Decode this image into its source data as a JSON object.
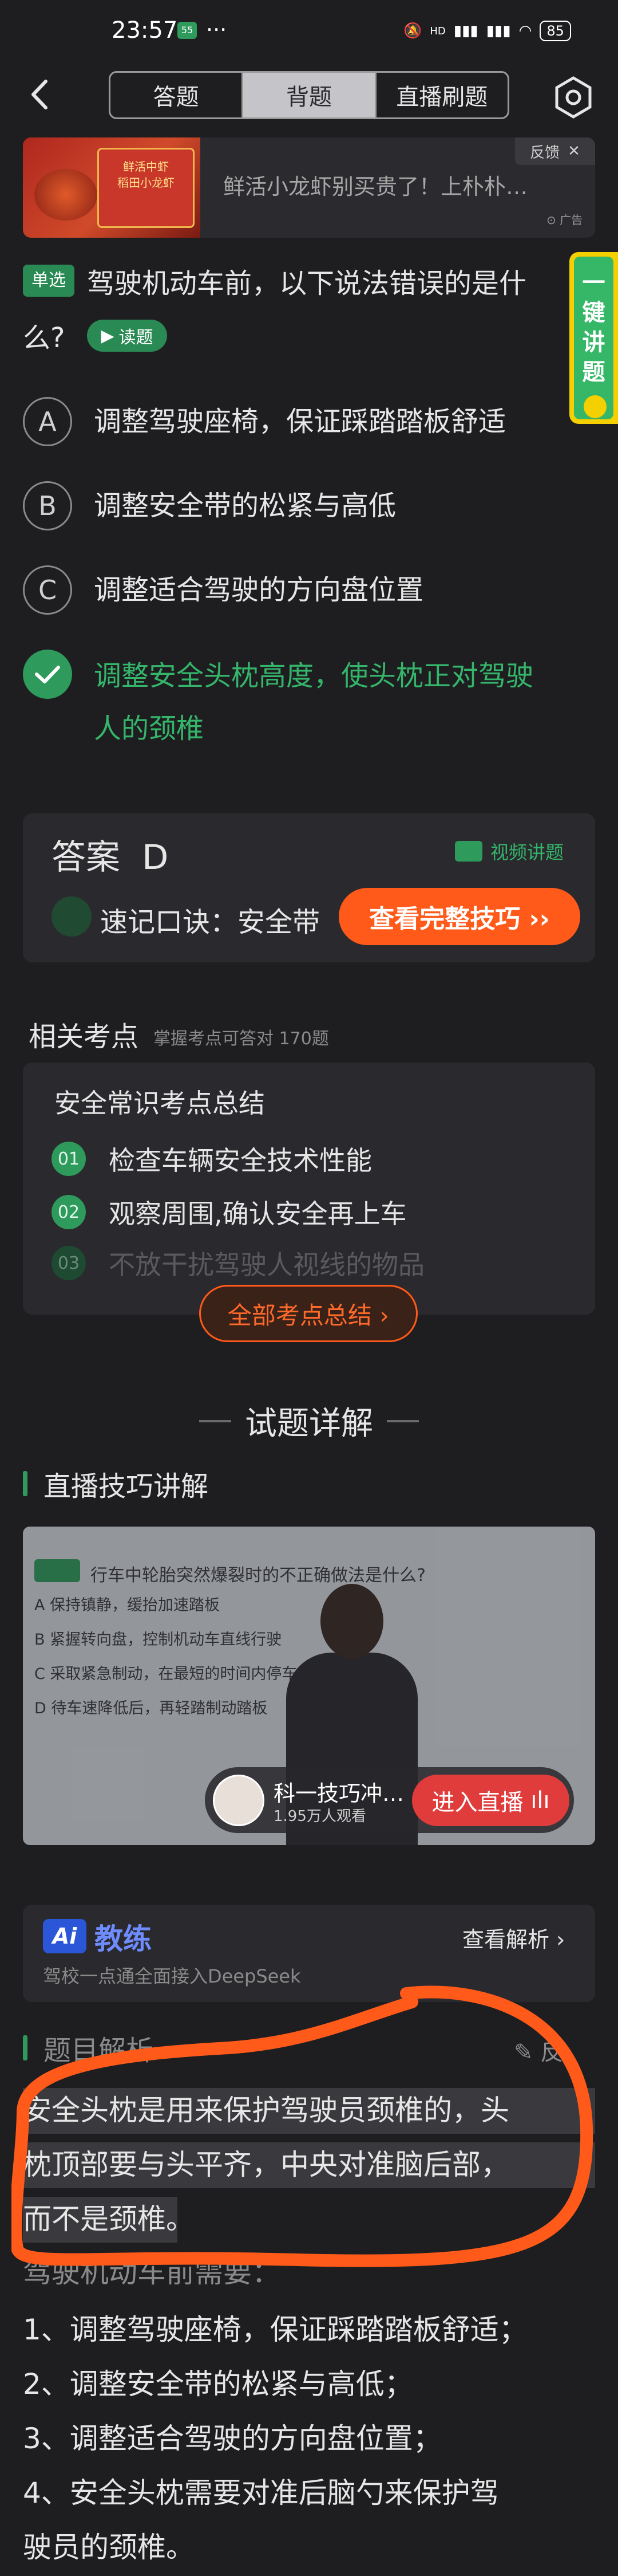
{
  "status": {
    "time": "23:57",
    "app_badge": "55",
    "dots": "···",
    "battery": "85",
    "signal": "HD"
  },
  "header": {
    "tabs": [
      "答题",
      "背题",
      "直播刷题"
    ],
    "active_tab": 1
  },
  "ad": {
    "text": "鲜活小龙虾别买贵了！上朴朴…",
    "feedback": "反馈",
    "tag": "广告",
    "image_text": "鲜活中虾\n稻田小龙虾"
  },
  "question": {
    "type": "单选",
    "line1": "驾驶机动车前，以下说法错误的是什",
    "line2": "么?",
    "read_label": "读题",
    "options": [
      {
        "letter": "A",
        "text": "调整驾驶座椅，保证踩踏踏板舒适"
      },
      {
        "letter": "B",
        "text": "调整安全带的松紧与高低"
      },
      {
        "letter": "C",
        "text": "调整适合驾驶的方向盘位置"
      },
      {
        "letter": "D",
        "text_lines": [
          "调整安全头枕高度，使头枕正对驾驶",
          "人的颈椎"
        ]
      }
    ]
  },
  "side_button": {
    "text": "一键讲题"
  },
  "answer": {
    "label": "答案",
    "value": "D",
    "video_label": "视频讲题",
    "memo": "速记口诀：安全带",
    "memo_button": "查看完整技巧 ››"
  },
  "related": {
    "title": "相关考点",
    "subtitle": "掌握考点可答对 170题",
    "card_title": "安全常识考点总结",
    "items": [
      {
        "num": "01",
        "text": "检查车辆安全技术性能"
      },
      {
        "num": "02",
        "text": "观察周围,确认安全再上车"
      },
      {
        "num": "03",
        "text": "不放干扰驾驶人视线的物品"
      }
    ],
    "all_button": "全部考点总结 ›"
  },
  "details": {
    "heading": "试题详解",
    "live_heading": "直播技巧讲解",
    "video": {
      "question": "行车中轮胎突然爆裂时的不正确做法是什么?",
      "options": [
        "A  保持镇静，缓抬加速踏板",
        "B  紧握转向盘，控制机动车直线行驶",
        "C  采取紧急制动，在最短的时间内停车",
        "D  待车速降低后，再轻踏制动踏板"
      ],
      "live_name": "科一技巧冲…",
      "live_count": "1.95万人观看",
      "live_button": "进入直播"
    }
  },
  "ai": {
    "logo": "Ai",
    "title": "教练",
    "subtitle": "驾校一点通全面接入DeepSeek",
    "link": "查看解析 ›"
  },
  "explanation": {
    "heading": "题目解析",
    "edit": "反",
    "highlight_lines": [
      "安全头枕是用来保护驾驶员颈椎的，头",
      "枕顶部要与头平齐，中央对准脑后部，",
      "而不是颈椎。"
    ],
    "intro": "驾驶机动车前需要：",
    "lines": [
      "1、调整驾驶座椅，保证踩踏踏板舒适；",
      "2、调整安全带的松紧与高低；",
      "3、调整适合驾驶的方向盘位置；",
      "4、安全头枕需要对准后脑勺来保护驾",
      "驶员的颈椎。"
    ]
  },
  "colors": {
    "accent_green": "#2e9a5b",
    "accent_orange": "#ff5a1a",
    "annotation_circle": "#ff5a1a"
  }
}
